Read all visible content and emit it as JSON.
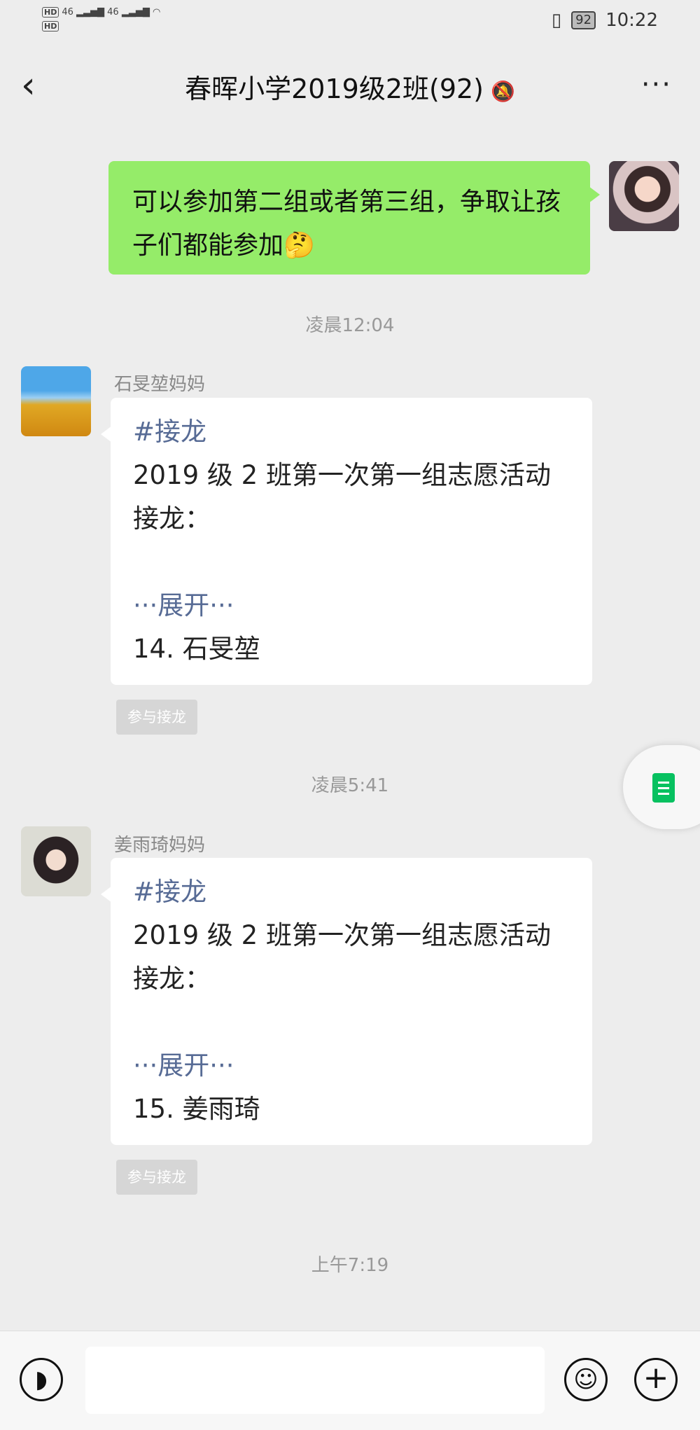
{
  "status_bar": {
    "hd1": "HD",
    "hd2": "HD",
    "net1": "46",
    "net2": "46",
    "battery": "92",
    "time": "10:22"
  },
  "header": {
    "title": "春晖小学2019级2班(92)"
  },
  "messages": {
    "self_text": "可以参加第二组或者第三组，争取让孩子们都能参加🤔",
    "time1": "凌晨12:04",
    "msg1": {
      "sender": "石旻堃妈妈",
      "tag": "#接龙",
      "line1": "2019 级 2 班第一次第一组志愿活动接龙：",
      "expand": "···展开···",
      "entry": "14. 石旻堃",
      "join": "参与接龙"
    },
    "time2": "凌晨5:41",
    "msg2": {
      "sender": "姜雨琦妈妈",
      "tag": "#接龙",
      "line1": "2019 级 2 班第一次第一组志愿活动接龙：",
      "expand": "···展开···",
      "entry": "15. 姜雨琦",
      "join": "参与接龙"
    },
    "time3": "上午7:19"
  },
  "icons": {
    "back": "chevron-left-icon",
    "mute": "mute-bell-icon",
    "more": "more-dots-icon",
    "voice": "voice-icon",
    "emoji": "emoji-icon",
    "plus": "plus-icon",
    "doc": "document-icon"
  },
  "colors": {
    "self_bubble": "#95ec69",
    "link": "#576b95",
    "doc_green": "#07c160"
  }
}
